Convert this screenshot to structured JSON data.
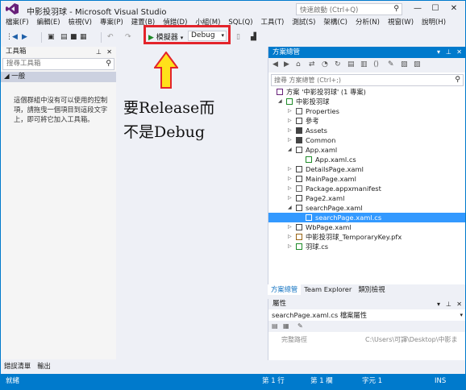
{
  "window": {
    "title": "中影投羽球 - Microsoft Visual Studio",
    "quick_launch_placeholder": "快速啟動 (Ctrl+Q)",
    "minimize": "—",
    "maximize": "☐",
    "close": "✕"
  },
  "menu": [
    "檔案(F)",
    "編輯(E)",
    "檢視(V)",
    "專案(P)",
    "建置(B)",
    "偵錯(D)",
    "小組(M)",
    "SQL(Q)",
    "工具(T)",
    "測試(S)",
    "架構(C)",
    "分析(N)",
    "視窗(W)",
    "說明(H)"
  ],
  "toolbar": {
    "run_label": "模擬器",
    "config_value": "Debug"
  },
  "toolbox": {
    "title": "工具箱",
    "search_placeholder": "搜尋工具箱",
    "group": "◢ 一般",
    "message": "這個群組中沒有可以使用的控制項，請拖曳一個項目到這段文字上，即可將它加入工具箱。"
  },
  "annotation": {
    "line1": "要Release而",
    "line2": "不是Debug",
    "arrow_color": "#ffe11a",
    "box_color": "#e3242b"
  },
  "solution_explorer": {
    "title": "方案總管",
    "search_placeholder": "搜尋 方案總管 (Ctrl+;)",
    "nodes": [
      {
        "label": "方案 '中影投羽球' (1 專案)",
        "level": 0,
        "icon": "solution-icon"
      },
      {
        "label": "中影投羽球",
        "level": 1,
        "icon": "project-icon"
      },
      {
        "label": "Properties",
        "level": 2,
        "icon": "properties-icon"
      },
      {
        "label": "參考",
        "level": 2,
        "icon": "references-icon"
      },
      {
        "label": "Assets",
        "level": 2,
        "icon": "folder-icon"
      },
      {
        "label": "Common",
        "level": 2,
        "icon": "folder-icon"
      },
      {
        "label": "App.xaml",
        "level": 2,
        "icon": "xaml-file-icon"
      },
      {
        "label": "App.xaml.cs",
        "level": 3,
        "icon": "cs-file-icon"
      },
      {
        "label": "DetailsPage.xaml",
        "level": 2,
        "icon": "xaml-file-icon"
      },
      {
        "label": "MainPage.xaml",
        "level": 2,
        "icon": "xaml-file-icon"
      },
      {
        "label": "Package.appxmanifest",
        "level": 2,
        "icon": "manifest-icon"
      },
      {
        "label": "Page2.xaml",
        "level": 2,
        "icon": "xaml-file-icon"
      },
      {
        "label": "searchPage.xaml",
        "level": 2,
        "icon": "xaml-file-icon"
      },
      {
        "label": "searchPage.xaml.cs",
        "level": 3,
        "icon": "cs-file-icon",
        "selected": true
      },
      {
        "label": "WbPage.xaml",
        "level": 2,
        "icon": "xaml-file-icon"
      },
      {
        "label": "中影投羽球_TemporaryKey.pfx",
        "level": 2,
        "icon": "key-file-icon"
      },
      {
        "label": "羽球.cs",
        "level": 2,
        "icon": "cs-file-icon"
      }
    ],
    "tabs": [
      "方案總管",
      "Team Explorer",
      "類別檢視"
    ]
  },
  "properties": {
    "title": "屬性",
    "object": "searchPage.xaml.cs 檔案屬性",
    "row_name": "完整路徑",
    "row_value": "C:\\Users\\可譯\\Desktop\\中影ま"
  },
  "bottom_tabs": [
    "錯誤清單",
    "輸出"
  ],
  "status": {
    "ready": "就緒",
    "line": "第 1 行",
    "col": "第 1 欄",
    "char": "字元 1",
    "mode": "INS"
  }
}
